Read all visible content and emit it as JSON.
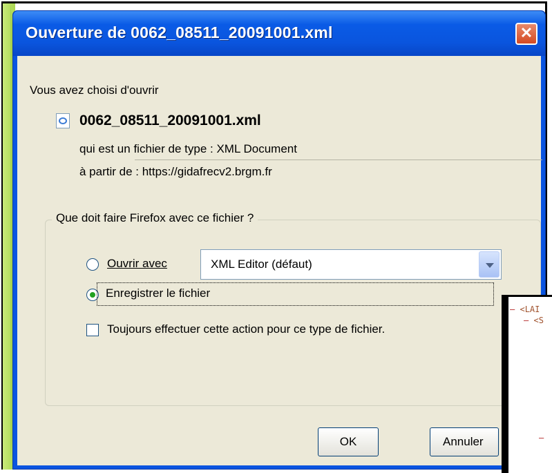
{
  "dialog": {
    "title": "Ouverture de 0062_08511_20091001.xml",
    "close_glyph": "✕",
    "intro_text": "Vous avez choisi d'ouvrir",
    "file_name": "0062_08511_20091001.xml",
    "file_type_line": "qui est un fichier de type :  XML Document",
    "source_line": "à partir de :  https://gidafrecv2.brgm.fr",
    "group_legend": "Que doit faire Firefox avec ce fichier ?",
    "option_open": {
      "label": "Ouvrir avec",
      "selected": false
    },
    "application_select": {
      "value": "XML Editor (défaut)"
    },
    "option_save": {
      "label": "Enregistrer le fichier",
      "selected": true
    },
    "always_checkbox": {
      "label": "Toujours effectuer cette action pour ce type de fichier.",
      "checked": false
    },
    "ok_button": "OK",
    "cancel_button": "Annuler"
  },
  "code_overlay": {
    "line1_dash": "–",
    "line1_tag": "<LAI",
    "line2_dash": "–",
    "line2_tag": "<S",
    "line3_dash": "–"
  },
  "colors": {
    "titlebar": "#0a55de",
    "client": "#ece9d8",
    "accent_green": "#a7d24d",
    "close_red": "#d54a22"
  }
}
